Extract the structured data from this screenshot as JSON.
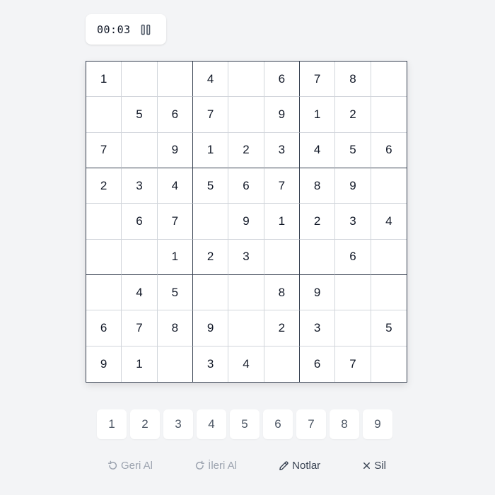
{
  "timer": {
    "value": "00:03",
    "pause_icon": "pause-icon"
  },
  "board": {
    "rows": [
      [
        "1",
        "",
        "",
        "4",
        "",
        "6",
        "7",
        "8",
        ""
      ],
      [
        "",
        "5",
        "6",
        "7",
        "",
        "9",
        "1",
        "2",
        ""
      ],
      [
        "7",
        "",
        "9",
        "1",
        "2",
        "3",
        "4",
        "5",
        "6"
      ],
      [
        "2",
        "3",
        "4",
        "5",
        "6",
        "7",
        "8",
        "9",
        ""
      ],
      [
        "",
        "6",
        "7",
        "",
        "9",
        "1",
        "2",
        "3",
        "4"
      ],
      [
        "",
        "",
        "1",
        "2",
        "3",
        "",
        "",
        "6",
        ""
      ],
      [
        "",
        "4",
        "5",
        "",
        "",
        "8",
        "9",
        "",
        ""
      ],
      [
        "6",
        "7",
        "8",
        "9",
        "",
        "2",
        "3",
        "",
        "5"
      ],
      [
        "9",
        "1",
        "",
        "3",
        "4",
        "",
        "6",
        "7",
        ""
      ]
    ]
  },
  "numpad": [
    "1",
    "2",
    "3",
    "4",
    "5",
    "6",
    "7",
    "8",
    "9"
  ],
  "actions": {
    "undo": {
      "label": "Geri Al",
      "icon": "undo-icon",
      "enabled": false
    },
    "redo": {
      "label": "İleri Al",
      "icon": "redo-icon",
      "enabled": false
    },
    "notes": {
      "label": "Notlar",
      "icon": "pencil-icon",
      "enabled": true
    },
    "erase": {
      "label": "Sil",
      "icon": "close-icon",
      "enabled": true
    }
  },
  "colors": {
    "background": "#f3f4f6",
    "board_border": "#374151",
    "cell_border": "#d1d5db",
    "disabled_text": "#9ca3af",
    "enabled_text": "#374151"
  }
}
